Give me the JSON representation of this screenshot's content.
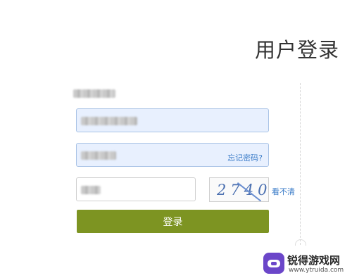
{
  "header": {
    "title": "用户登录"
  },
  "form": {
    "username": {
      "value": ""
    },
    "password": {
      "value": ""
    },
    "forgot_label": "忘记密码?",
    "captcha": {
      "value": "",
      "image_text": "2740",
      "refresh_label": "看不清"
    },
    "login_label": "登录"
  },
  "watermark": {
    "name": "锐得游戏网",
    "url": "www.ytruida.com"
  },
  "colors": {
    "login_button": "#7d9422",
    "filled_field": "#e8f0fe",
    "link": "#3a7bc8"
  }
}
